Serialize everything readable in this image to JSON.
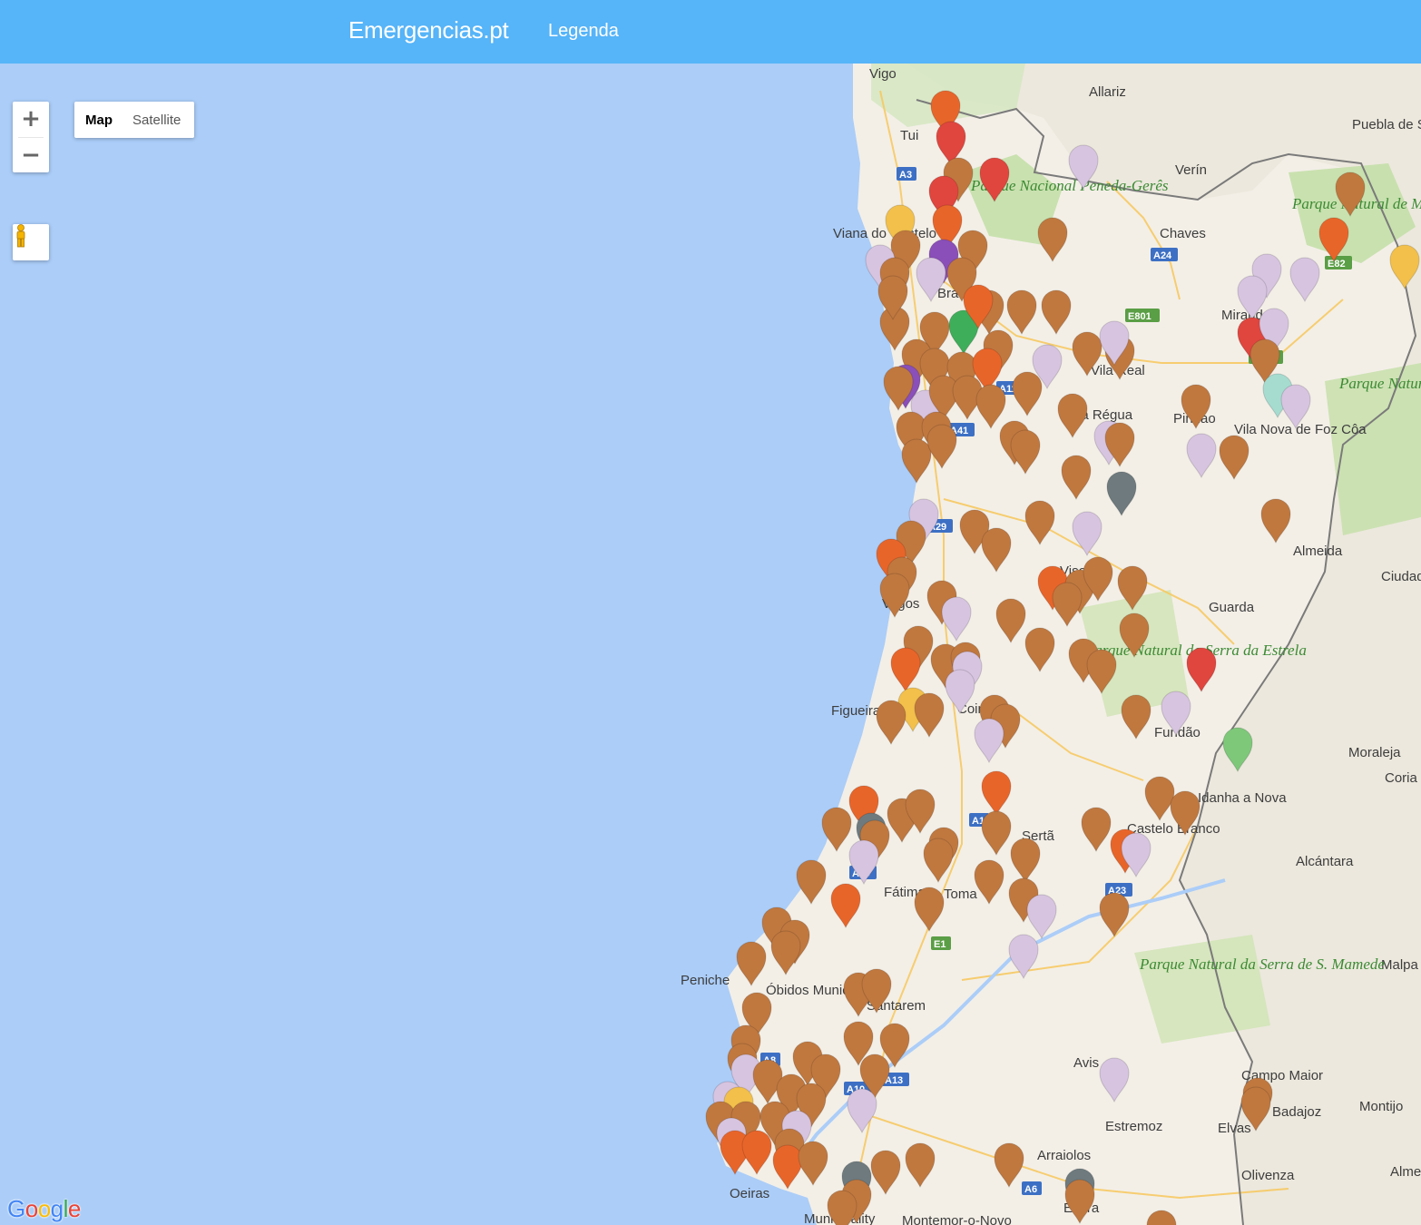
{
  "navbar": {
    "brand": "Emergencias.pt",
    "legend_link": "Legenda",
    "background": "#56b4f8"
  },
  "map_controls": {
    "zoom_in": "+",
    "zoom_out": "−",
    "map_type_map": "Map",
    "map_type_satellite": "Satellite",
    "active_map_type": "Map",
    "street_view_icon": "pegman-icon"
  },
  "attribution": {
    "logo_text": "Google"
  },
  "map_labels": {
    "cities": [
      "Vigo",
      "Allariz",
      "Tui",
      "Verín",
      "Puebla de Sanabria",
      "Viana do Castelo",
      "Chaves",
      "Bra",
      "Miranda",
      "Vila Real",
      "Pinhao",
      "Vila Nova de Foz Côa",
      "da Régua",
      "Almeida",
      "Ciudad Rodrig",
      "Vise",
      "Guarda",
      "Vagos",
      "Figueira da Foz",
      "Coimbr",
      "Fundão",
      "Moraleja",
      "Coria",
      "Idanha a Nova",
      "Castelo Branco",
      "Sertã",
      "Alcántara",
      "Fátima",
      "Toma",
      "Peniche",
      "Óbidos Municipality",
      "Santarem",
      "Malpa de Các",
      "Avis",
      "Campo Maior",
      "Badajoz",
      "Montijo",
      "Elvas",
      "Estremoz",
      "Arraiolos",
      "Oeiras",
      "Montemor-o-Novo",
      "Olivenza",
      "Alme",
      "Municipality",
      "Évora"
    ],
    "parks": [
      "Parque Nacional Peneda-Gerês",
      "Parque Natural de Montesinho",
      "Parque Natural de Arribes del Duero",
      "Parque Natural da Serra da Estrela",
      "Parque Natural da Serra de S. Mamede"
    ],
    "roads": [
      "A3",
      "A24",
      "E82",
      "E801",
      "E802",
      "A11",
      "A41",
      "A23",
      "A19",
      "A13",
      "A10",
      "A6",
      "E1",
      "A29",
      "A1",
      "A8"
    ]
  },
  "markers": {
    "colors": {
      "brown": "#c0783f",
      "orange": "#e8652a",
      "red": "#e0463e",
      "lilac": "#d7c4e0",
      "yellow": "#f2c04b",
      "purple": "#8a4fb8",
      "green": "#3fae5a",
      "lightgreen": "#7ec87a",
      "teal": "#a6dcd0",
      "gray": "#6e7a7e"
    }
  }
}
